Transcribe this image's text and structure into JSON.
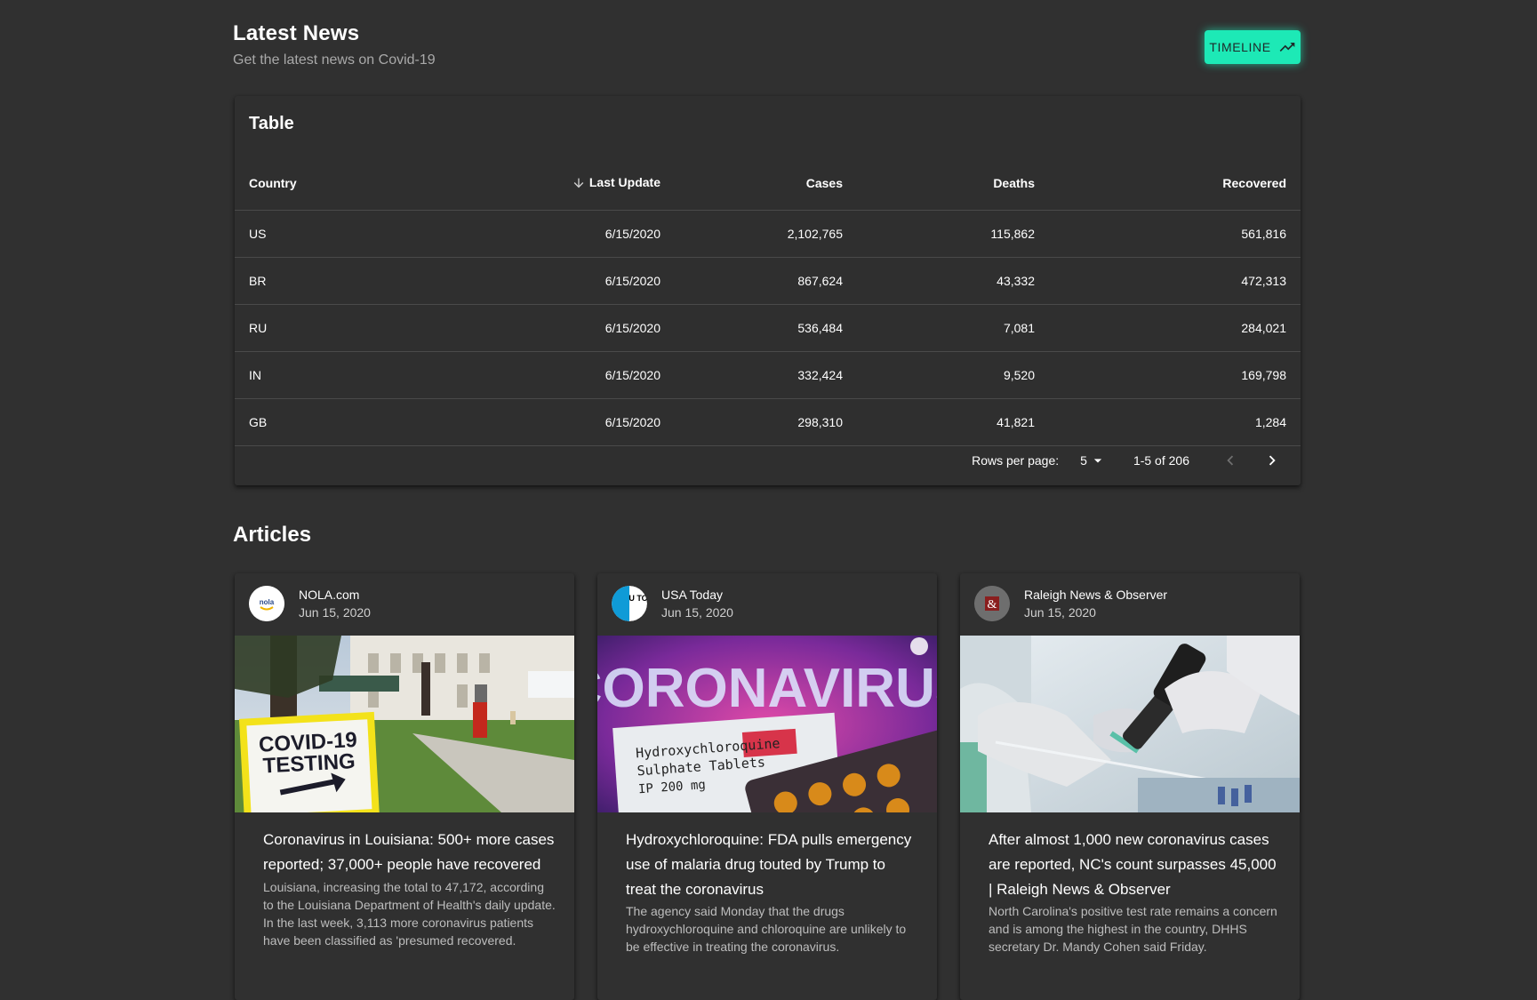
{
  "header": {
    "title": "Latest News",
    "subtitle": "Get the latest news on Covid-19",
    "timeline_label": "TIMELINE"
  },
  "table": {
    "title": "Table",
    "columns": [
      "Country",
      "Last Update",
      "Cases",
      "Deaths",
      "Recovered"
    ],
    "rows": [
      [
        "US",
        "6/15/2020",
        "2,102,765",
        "115,862",
        "561,816"
      ],
      [
        "BR",
        "6/15/2020",
        "867,624",
        "43,332",
        "472,313"
      ],
      [
        "RU",
        "6/15/2020",
        "536,484",
        "7,081",
        "284,021"
      ],
      [
        "IN",
        "6/15/2020",
        "332,424",
        "9,520",
        "169,798"
      ],
      [
        "GB",
        "6/15/2020",
        "298,310",
        "41,821",
        "1,284"
      ]
    ],
    "sorted_column": "Last Update",
    "sort_direction": "descending",
    "pagination": {
      "rows_per_page_label": "Rows per page:",
      "rows_per_page": "5",
      "range": "1-5 of 206"
    }
  },
  "articles": {
    "title": "Articles",
    "items": [
      {
        "source": "NOLA.com",
        "date": "Jun 15, 2020",
        "title": "Coronavirus in Louisiana: 500+ more cases reported; 37,000+ people have recovered",
        "description": "Louisiana, increasing the total to 47,172, according to the Louisiana Department of Health's daily update. In the last week, 3,113 more coronavirus patients have been classified as 'presumed recovered.",
        "image_sign_text_1": "COVID-19",
        "image_sign_text_2": "TESTING",
        "avatar_text": "nola"
      },
      {
        "source": "USA Today",
        "date": "Jun 15, 2020",
        "title": "Hydroxychloroquine: FDA pulls emergency use of malaria drug touted by Trump to treat the coronavirus",
        "description": "The agency said Monday that the drugs hydroxychloroquine and chloroquine are unlikely to be effective in treating the coronavirus.",
        "image_banner_text": "CORONAVIRUS",
        "image_box_line_1": "Hydroxychloroquine",
        "image_box_line_2": "Sulphate Tablets",
        "image_box_line_3": "IP 200 mg",
        "avatar_text": "U TO"
      },
      {
        "source": "Raleigh News & Observer",
        "date": "Jun 15, 2020",
        "title": "After almost 1,000 new coronavirus cases are reported, NC's count surpasses 45,000 | Raleigh News & Observer",
        "description": "North Carolina's positive test rate remains a concern and is among the highest in the country, DHHS secretary Dr. Mandy Cohen said Friday.",
        "avatar_text": "&"
      }
    ]
  },
  "colors": {
    "background": "#303030",
    "accent": "#1de9b6",
    "divider": "#4a4a4a",
    "muted_text": "#a9a9a9"
  }
}
